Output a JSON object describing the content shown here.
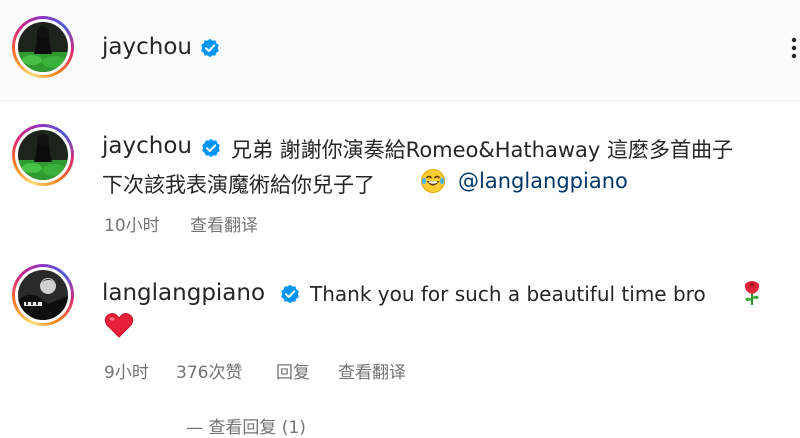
{
  "post_header": {
    "username": "jaychou"
  },
  "comments": [
    {
      "username": "jaychou",
      "text_line1": "兄弟 謝謝你演奏給Romeo&Hathaway 這麼多首曲子",
      "text_line2": "下次該我表演魔術給你兒子了",
      "emoji": "laughing-tears-emoji",
      "mention": "@langlangpiano",
      "time": "10小时",
      "see_translation": "查看翻译"
    },
    {
      "username": "langlangpiano",
      "text": "Thank you for such a beautiful time bro",
      "emoji1": "rose-emoji",
      "emoji2": "red-heart-emoji",
      "time": "9小时",
      "likes": "376次赞",
      "reply": "回复",
      "see_translation": "查看翻译"
    }
  ],
  "view_replies": "— 查看回复 (1)",
  "colors": {
    "text": "#262626",
    "secondary": "#737373",
    "verified": "#0095f6",
    "mention": "#00376b"
  }
}
